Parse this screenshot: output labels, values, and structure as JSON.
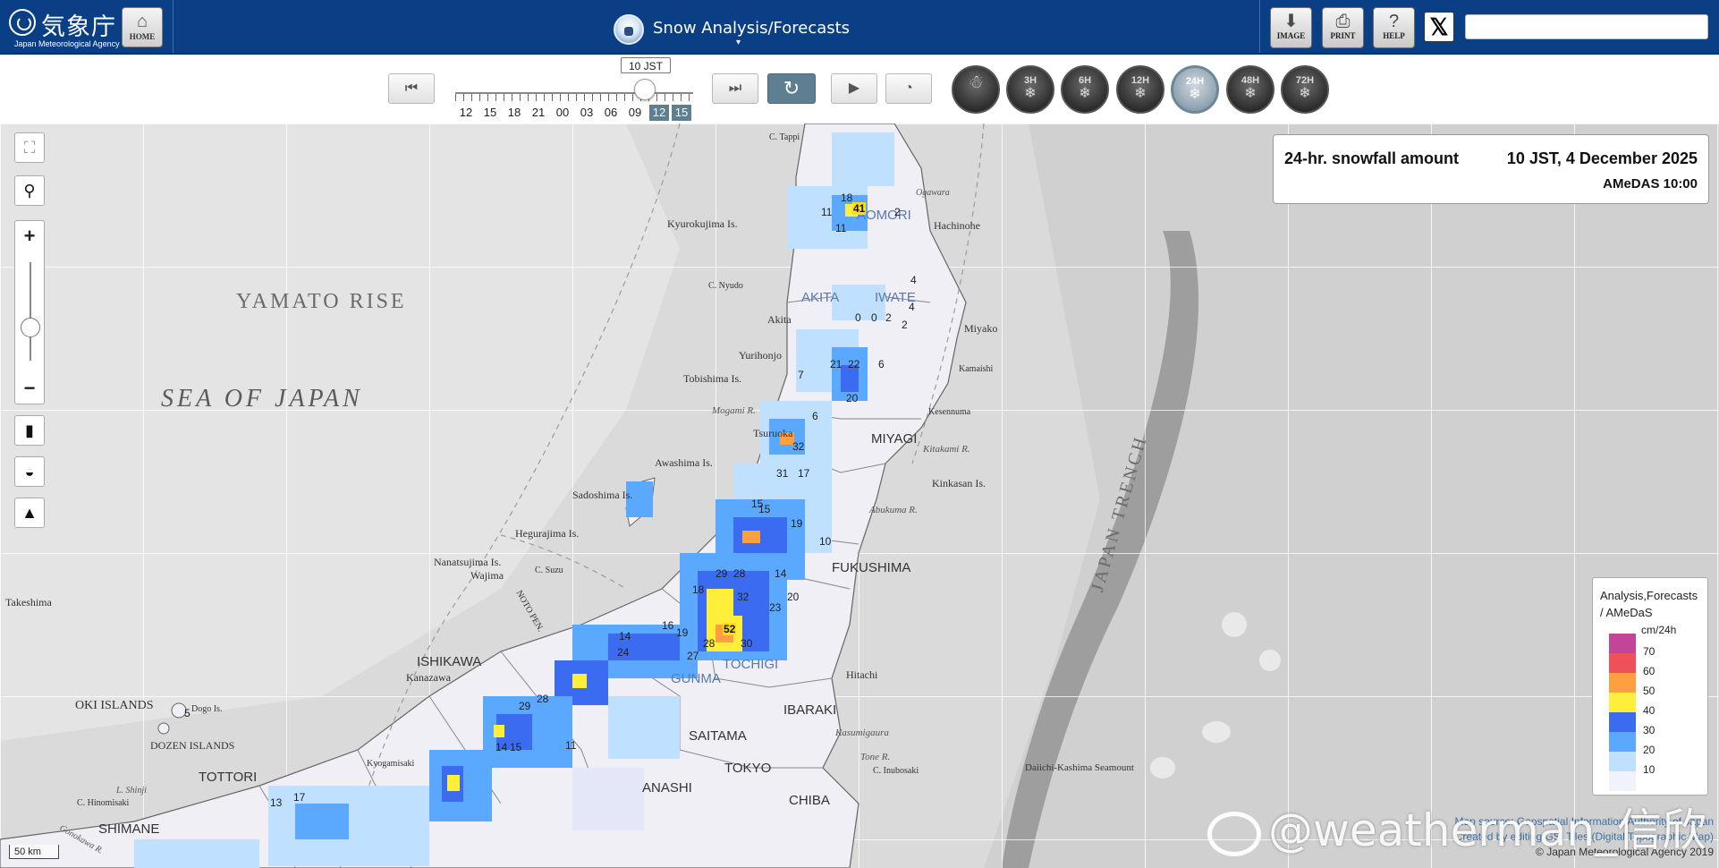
{
  "header": {
    "logo_kanji": "気象庁",
    "logo_en": "Japan Meteorological Agency",
    "home_label": "HOME",
    "title": "Snow Analysis/Forecasts",
    "title_caret": "▾",
    "image_label": "IMAGE",
    "print_label": "PRINT",
    "help_label": "HELP",
    "x_label": "𝕏",
    "search_placeholder": ""
  },
  "timebar": {
    "current_tooltip": "10 JST",
    "hours": [
      "12",
      "15",
      "18",
      "21",
      "00",
      "03",
      "06",
      "09",
      "12",
      "15"
    ],
    "selected_hours": [
      8,
      9
    ],
    "first_icon": "first-frame-icon",
    "last_icon": "last-frame-icon",
    "refresh_icon": "refresh-icon",
    "play_icon": "play-icon",
    "speed_icon": "speed-icon"
  },
  "ranges": {
    "items": [
      {
        "label": "",
        "icon": "snow-depth-icon"
      },
      {
        "label": "3H",
        "icon": "snowfall-icon"
      },
      {
        "label": "6H",
        "icon": "snowfall-icon"
      },
      {
        "label": "12H",
        "icon": "snowfall-icon"
      },
      {
        "label": "24H",
        "icon": "snowfall-icon",
        "selected": true
      },
      {
        "label": "48H",
        "icon": "snowfall-icon"
      },
      {
        "label": "72H",
        "icon": "snowfall-icon"
      }
    ]
  },
  "map_tools": {
    "fullscreen_icon": "fullscreen-icon",
    "location_icon": "location-pin-icon",
    "zoom_in": "+",
    "zoom_out": "−",
    "basemap_icon": "map-icon",
    "hydro_icon": "water-drop-icon",
    "terrain_icon": "mountain-icon"
  },
  "info": {
    "product": "24-hr. snowfall amount",
    "valid_time": "10 JST, 4 December 2025",
    "amedas": "AMeDAS  10:00"
  },
  "map_labels": {
    "sea": "SEA OF JAPAN",
    "rise": "YAMATO RISE",
    "trench": "JAPAN TRENCH",
    "fukushima": "FUKUSHIMA",
    "ishikawa": "ISHIKAWA",
    "ibaraki": "IBARAKI",
    "tottori": "TOTTORI",
    "tokyo": "TOKYO",
    "chiba": "CHIBA",
    "yamanashi": "ANASHI",
    "saitama": "SAITAMA",
    "gunma": "GUNMA",
    "tochigi": "TOCHIGI",
    "akita": "AKITA",
    "iwate": "IWATE",
    "aomori": "AOMORI",
    "miyagi": "MIYAGI",
    "shimane": "SHIMANE",
    "oki": "OKI ISLANDS",
    "dozen": "DOZEN ISLANDS",
    "sadoshima": "Sadoshima Is.",
    "awashima": "Awashima Is.",
    "tobishima": "Tobishima Is.",
    "hegurajima": "Hegurajima Is.",
    "nanatsujima": "Nanatsujima Is.",
    "kyurokujima": "Kyurokujima Is.",
    "takeshima": "Takeshima",
    "miyako": "Miyako",
    "hachinohe": "Hachinohe",
    "kinkasan": "Kinkasan Is.",
    "seamount": "Daiichi-Kashima Seamount",
    "wajima": "Wajima",
    "yurihonjo": "Yurihonjo",
    "kanazawa": "Kanazawa",
    "hitachi": "Hitachi",
    "akita_city": "Akita",
    "tsuruoka": "Tsuruoka",
    "mogami": "Mogami R.",
    "abukuma": "Abukuma R.",
    "kitakami": "Kitakami R.",
    "kasumigaura": "Kasumigaura",
    "tone": "Tone R.",
    "inubosaki": "C. Inubosaki",
    "dogo": "Dogo Is.",
    "noto": "NOTO PEN.",
    "sennuma": "Kesennuma",
    "kamaishi": "Kamaishi",
    "okawara": "Ogawara",
    "tappi": "C. Tappi",
    "kitaura": "C. Nyudo",
    "hinomisaki": "C. Hinomisaki",
    "gonokawa": "Gonokawa R.",
    "suzu": "C. Suzu",
    "kyogamisaki": "Kyogamisaki",
    "genkai": "L. Shinji"
  },
  "amedas_values": [
    {
      "v": "41",
      "hi": true
    },
    {
      "v": "18"
    },
    {
      "v": "11"
    },
    {
      "v": "11"
    },
    {
      "v": "2"
    },
    {
      "v": "4"
    },
    {
      "v": "0"
    },
    {
      "v": "2"
    },
    {
      "v": "2"
    },
    {
      "v": "4"
    },
    {
      "v": "0"
    },
    {
      "v": "6"
    },
    {
      "v": "21"
    },
    {
      "v": "22"
    },
    {
      "v": "20"
    },
    {
      "v": "7"
    },
    {
      "v": "6"
    },
    {
      "v": "32"
    },
    {
      "v": "17"
    },
    {
      "v": "31"
    },
    {
      "v": "15"
    },
    {
      "v": "19"
    },
    {
      "v": "14"
    },
    {
      "v": "28"
    },
    {
      "v": "32"
    },
    {
      "v": "18"
    },
    {
      "v": "29"
    },
    {
      "v": "20"
    },
    {
      "v": "52",
      "hi": true
    },
    {
      "v": "30"
    },
    {
      "v": "28"
    },
    {
      "v": "16"
    },
    {
      "v": "19"
    },
    {
      "v": "14"
    },
    {
      "v": "24"
    },
    {
      "v": "23"
    },
    {
      "v": "27"
    },
    {
      "v": "29"
    },
    {
      "v": "28"
    },
    {
      "v": "15"
    },
    {
      "v": "14"
    },
    {
      "v": "17"
    },
    {
      "v": "13"
    },
    {
      "v": "11"
    },
    {
      "v": "5"
    },
    {
      "v": "10"
    },
    {
      "v": "15"
    }
  ],
  "legend": {
    "title_line1": "Analysis,Forecasts",
    "title_line2": "/ AMeDaS",
    "unit": "cm/24h",
    "levels": [
      "70",
      "60",
      "50",
      "40",
      "30",
      "20",
      "10"
    ],
    "colors": [
      "#c4449a",
      "#f0505a",
      "#ffa040",
      "#ffef3a",
      "#3b6bf0",
      "#5aa8ff",
      "#bfe0ff",
      "#f2f2fb"
    ]
  },
  "scale": "50 km",
  "credit": {
    "line1": "Map source: Geospatial Information Authority of Japan",
    "line2": "Created by editing GSI Tiles (Digital Topographic Map)",
    "line3": "© Japan Meteorological Agency 2019"
  },
  "watermark": "@weatherman_信欣"
}
